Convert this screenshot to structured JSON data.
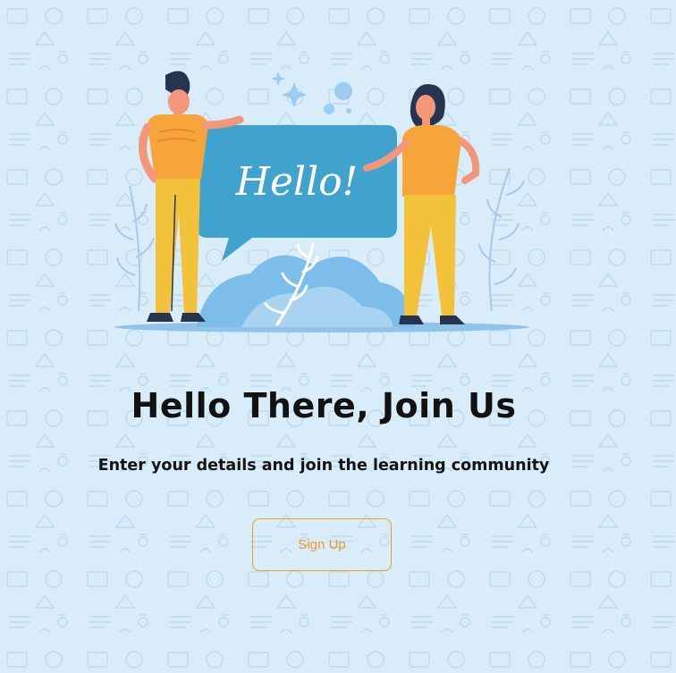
{
  "hero": {
    "bubble_text": "Hello!",
    "title": "Hello There, Join Us",
    "subtitle": "Enter your details and join the learning community"
  },
  "actions": {
    "signup_label": "Sign Up"
  },
  "colors": {
    "background": "#d9ecfa",
    "accent": "#f29b21",
    "bubble": "#3fa3cd",
    "shirt": "#f7a53a",
    "pants": "#f2c23a"
  },
  "icons": [
    "school-doodle-pattern",
    "welcome-illustration",
    "plant-icon",
    "sparkle-icon"
  ]
}
